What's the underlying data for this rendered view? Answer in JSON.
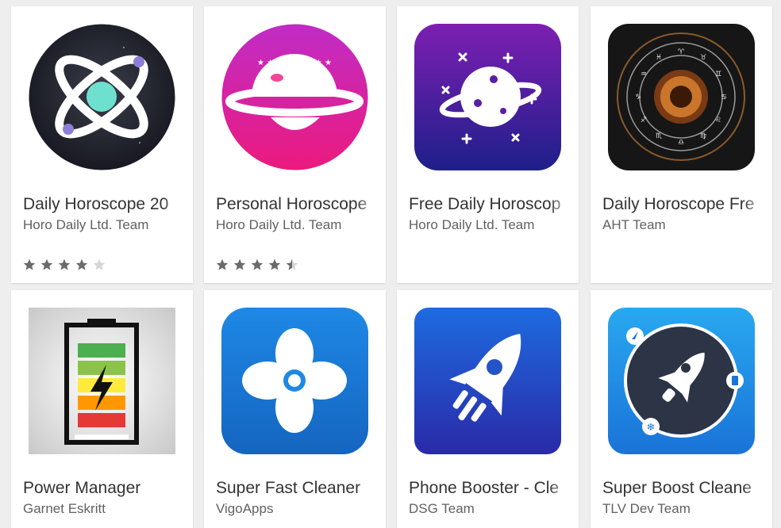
{
  "apps": [
    {
      "title": "Daily Horoscope 20",
      "developer": "Horo Daily Ltd. Team",
      "rating": 4,
      "icon": "atom-orbit-icon"
    },
    {
      "title": "Personal Horoscope",
      "developer": "Horo Daily Ltd. Team",
      "rating": 4.5,
      "icon": "ringed-planet-icon"
    },
    {
      "title": "Free Daily Horoscop",
      "developer": "Horo Daily Ltd. Team",
      "rating": null,
      "icon": "planet-stars-icon"
    },
    {
      "title": "Daily Horoscope Fre",
      "developer": "AHT Team",
      "rating": null,
      "icon": "zodiac-wheel-icon"
    },
    {
      "title": "Power Manager",
      "developer": "Garnet Eskritt",
      "rating": null,
      "icon": "battery-bolt-icon"
    },
    {
      "title": "Super Fast Cleaner",
      "developer": "VigoApps",
      "rating": null,
      "icon": "fan-icon"
    },
    {
      "title": "Phone Booster - Cle",
      "developer": "DSG Team",
      "rating": null,
      "icon": "rocket-icon"
    },
    {
      "title": "Super Boost Cleane",
      "developer": "TLV Dev Team",
      "rating": null,
      "icon": "rocket-orbit-icon"
    }
  ],
  "colors": {
    "star_filled": "#6b6b6b",
    "star_empty": "#d6d6d6"
  }
}
